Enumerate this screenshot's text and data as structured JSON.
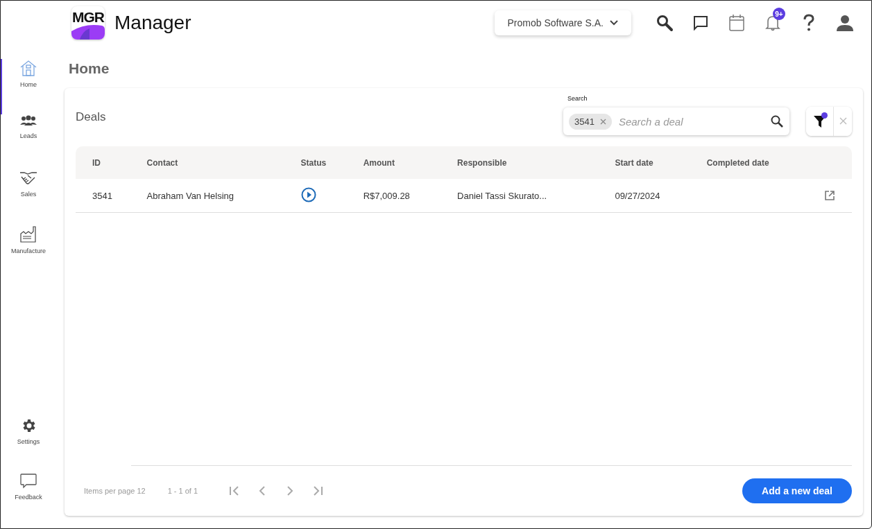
{
  "app": {
    "logo_text": "MGR",
    "title": "Manager"
  },
  "company_selector": {
    "label": "Promob Software S.A."
  },
  "notifications": {
    "badge": "9+"
  },
  "sidebar": {
    "items": [
      {
        "label": "Home",
        "selected": true
      },
      {
        "label": "Leads",
        "selected": false
      },
      {
        "label": "Sales",
        "selected": false
      },
      {
        "label": "Manufacture",
        "selected": false
      }
    ],
    "bottom_items": [
      {
        "label": "Settings"
      },
      {
        "label": "Feedback"
      }
    ]
  },
  "page_title": "Home",
  "card": {
    "title": "Deals",
    "search": {
      "label": "Search",
      "chip": "3541",
      "placeholder": "Search a deal"
    },
    "filter": {
      "active": true
    },
    "table": {
      "columns": [
        "ID",
        "Contact",
        "Status",
        "Amount",
        "Responsible",
        "Start date",
        "Completed date"
      ],
      "rows": [
        {
          "id": "3541",
          "contact": "Abraham Van Helsing",
          "amount": "R$7,009.28",
          "responsible": "Daniel Tassi Skurato...",
          "start_date": "09/27/2024"
        }
      ]
    },
    "pagination": {
      "items_per_page_label": "Items per page",
      "items_per_page": "12",
      "range": "1 - 1 of 1"
    },
    "primary_button": "Add a new deal"
  }
}
